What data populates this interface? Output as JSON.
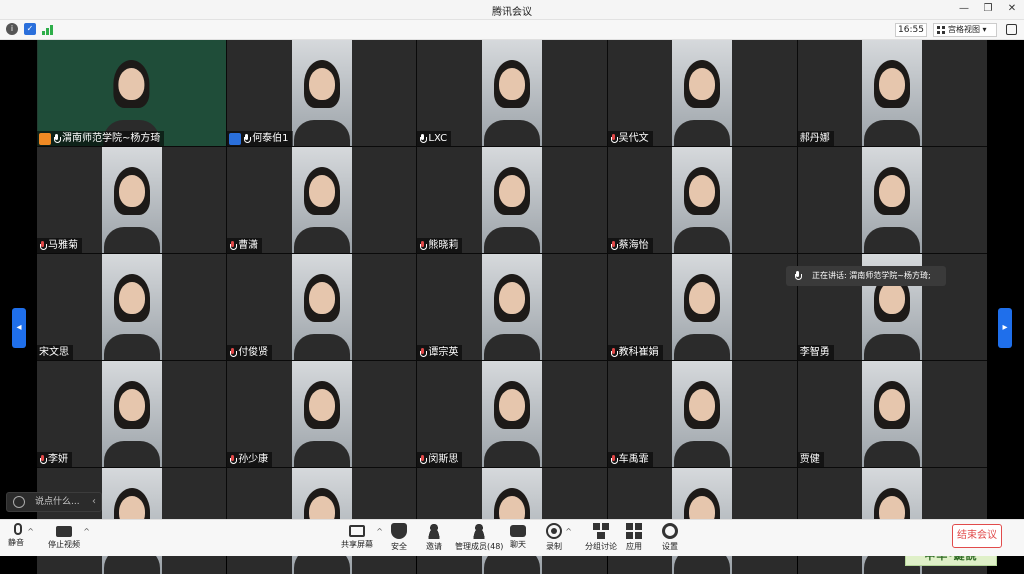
{
  "window": {
    "title": "腾讯会议"
  },
  "topbar": {
    "time": "16:55",
    "view_label": "宫格视图",
    "view_caret": "▾"
  },
  "tiles": [
    {
      "name": "渭南师范学院~杨方琦",
      "role": "host",
      "muted": false,
      "bg": "chalk"
    },
    {
      "name": "何泰伯1",
      "role": "cohost",
      "muted": false,
      "bg": "landscape"
    },
    {
      "name": "LXC",
      "role": "",
      "muted": false,
      "bg": "room"
    },
    {
      "name": "吴代文",
      "role": "",
      "muted": true,
      "bg": "room"
    },
    {
      "name": "郝丹娜",
      "role": "",
      "muted": false,
      "bg": "room",
      "nomic": true
    },
    {
      "name": "马雅菊",
      "role": "",
      "muted": true,
      "bg": "room"
    },
    {
      "name": "曹潇",
      "role": "",
      "muted": true,
      "bg": "room"
    },
    {
      "name": "熊晓莉",
      "role": "",
      "muted": true,
      "bg": "room"
    },
    {
      "name": "蔡海怡",
      "role": "",
      "muted": true,
      "bg": "room"
    },
    {
      "name": "",
      "role": "",
      "muted": true,
      "bg": "room"
    },
    {
      "name": "宋文思",
      "role": "",
      "muted": false,
      "bg": "room",
      "nomic": true
    },
    {
      "name": "付俊贤",
      "role": "",
      "muted": true,
      "bg": "room"
    },
    {
      "name": "谭宗英",
      "role": "",
      "muted": true,
      "bg": "room"
    },
    {
      "name": "教科崔娟",
      "role": "",
      "muted": true,
      "bg": "room"
    },
    {
      "name": "李智勇",
      "role": "",
      "muted": false,
      "bg": "room",
      "nomic": true
    },
    {
      "name": "李妍",
      "role": "",
      "muted": true,
      "bg": "room"
    },
    {
      "name": "孙少康",
      "role": "",
      "muted": true,
      "bg": "room"
    },
    {
      "name": "闵斯思",
      "role": "",
      "muted": true,
      "bg": "room"
    },
    {
      "name": "车禹霏",
      "role": "",
      "muted": true,
      "bg": "room"
    },
    {
      "name": "贾健",
      "role": "",
      "muted": false,
      "bg": "room",
      "nomic": true
    },
    {
      "name": "",
      "role": "",
      "muted": false,
      "bg": "room",
      "nomic": true
    },
    {
      "name": "",
      "role": "",
      "muted": false,
      "bg": "room",
      "nomic": true
    },
    {
      "name": "",
      "role": "",
      "muted": false,
      "bg": "room",
      "nomic": true
    },
    {
      "name": "",
      "role": "",
      "muted": false,
      "bg": "room",
      "nomic": true
    },
    {
      "name": "",
      "role": "",
      "muted": false,
      "bg": "room",
      "nomic": true
    }
  ],
  "speaking": {
    "label": "正在讲话: 渭南师范学院~杨方琦;"
  },
  "chat": {
    "placeholder": "说点什么..."
  },
  "watermark": {
    "text": "中华·鍵說"
  },
  "toolbar": {
    "mute": "静音",
    "stop_video": "停止视频",
    "share": "共享屏幕",
    "security": "安全",
    "invite": "邀请",
    "participants": "管理成员(48)",
    "chat": "聊天",
    "record": "录制",
    "breakout": "分组讨论",
    "apps": "应用",
    "settings": "设置",
    "end": "结束会议"
  },
  "colors": {
    "accent": "#1f6feb",
    "end": "#e14b4b",
    "host": "#f08a24",
    "cohost": "#2a6fdb"
  }
}
